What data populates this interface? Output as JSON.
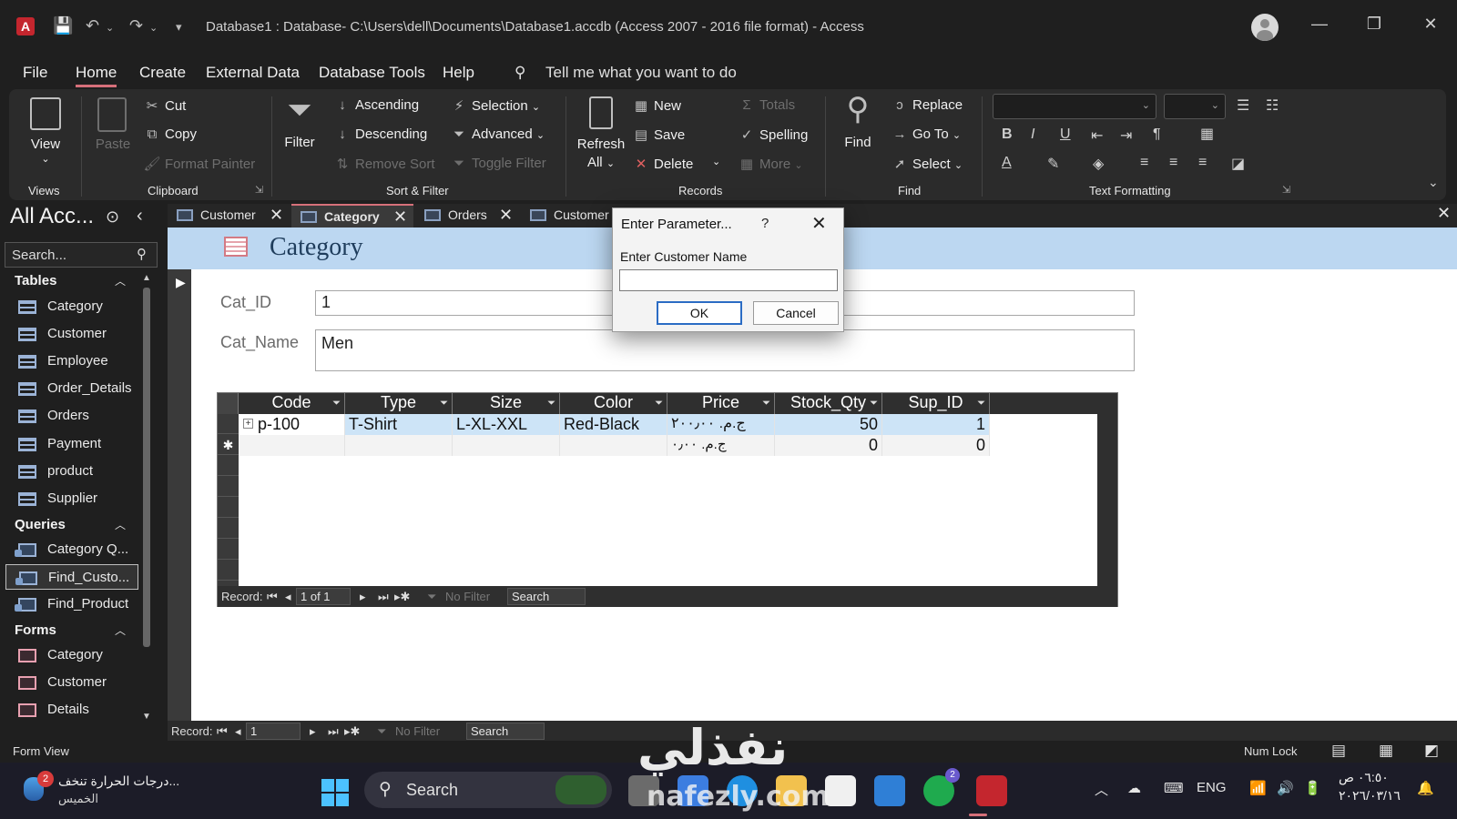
{
  "window": {
    "title": "Database1 : Database- C:\\Users\\dell\\Documents\\Database1.accdb (Access 2007 - 2016 file format)  -  Access"
  },
  "menu": {
    "tabs": [
      "File",
      "Home",
      "Create",
      "External Data",
      "Database Tools",
      "Help"
    ],
    "active": "Home",
    "tell_me": "Tell me what you want to do"
  },
  "ribbon": {
    "views": {
      "view": "View",
      "group": "Views"
    },
    "clipboard": {
      "paste": "Paste",
      "cut": "Cut",
      "copy": "Copy",
      "format_painter": "Format Painter",
      "group": "Clipboard"
    },
    "sort_filter": {
      "filter": "Filter",
      "ascending": "Ascending",
      "descending": "Descending",
      "remove_sort": "Remove Sort",
      "selection": "Selection",
      "advanced": "Advanced",
      "toggle_filter": "Toggle Filter",
      "group": "Sort & Filter"
    },
    "records": {
      "refresh": "Refresh",
      "refresh_all": "All",
      "new": "New",
      "save": "Save",
      "delete": "Delete",
      "totals": "Totals",
      "spelling": "Spelling",
      "more": "More",
      "group": "Records"
    },
    "find": {
      "find": "Find",
      "replace": "Replace",
      "goto": "Go To",
      "select": "Select",
      "group": "Find"
    },
    "text_formatting": {
      "group": "Text Formatting",
      "bold": "B",
      "italic": "I",
      "underline": "U"
    }
  },
  "nav": {
    "title": "All Acc...",
    "search_placeholder": "Search...",
    "tables_header": "Tables",
    "tables": [
      "Category",
      "Customer",
      "Employee",
      "Order_Details",
      "Orders",
      "Payment",
      "product",
      "Supplier"
    ],
    "queries_header": "Queries",
    "queries": [
      "Category Q...",
      "Find_Custo...",
      "Find_Product"
    ],
    "forms_header": "Forms",
    "forms": [
      "Category",
      "Customer",
      "Details"
    ]
  },
  "doc_tabs": [
    "Customer",
    "Category",
    "Orders",
    "Customer"
  ],
  "form": {
    "title": "Category",
    "cat_id_label": "Cat_ID",
    "cat_id_value": "1",
    "cat_name_label": "Cat_Name",
    "cat_name_value": "Men"
  },
  "subform": {
    "columns": [
      "Code",
      "Type",
      "Size",
      "Color",
      "Price",
      "Stock_Qty",
      "Sup_ID"
    ],
    "rows": [
      [
        "p-100",
        "T-Shirt",
        "L-XL-XXL",
        "Red-Black",
        "ج.م.‏ ٢٠٠٫٠٠",
        "50",
        "1"
      ]
    ],
    "new_row": [
      "",
      "",
      "",
      "",
      "ج.م.‏ ٠٫٠٠",
      "0",
      "0"
    ],
    "nav": {
      "record_label": "Record:",
      "position": "1 of 1",
      "no_filter": "No Filter",
      "search": "Search"
    }
  },
  "form_nav": {
    "record_label": "Record:",
    "position": "1",
    "no_filter": "No Filter",
    "search": "Search"
  },
  "status": {
    "left": "Form View",
    "num_lock": "Num Lock"
  },
  "dialog": {
    "title": "Enter Parameter...",
    "help": "?",
    "prompt": "Enter Customer Name",
    "value": "",
    "ok": "OK",
    "cancel": "Cancel"
  },
  "taskbar": {
    "weather_line1": "درجات الحرارة تنخف...",
    "weather_line2": "الخميس",
    "weather_badge": "2",
    "search": "Search",
    "lang": "ENG",
    "time": "٠٦:٥٠ ص",
    "date": "٢٠٢٦/٠٣/١٦",
    "whatsapp_badge": "2"
  },
  "watermark": {
    "arabic": "نفذلي",
    "latin": "nafezly.com"
  },
  "colors": {
    "accent": "#d6707a",
    "form_header": "#bcd7f1",
    "selected_cell": "#cde4f7",
    "dialog_ok_border": "#2b6cc4"
  }
}
